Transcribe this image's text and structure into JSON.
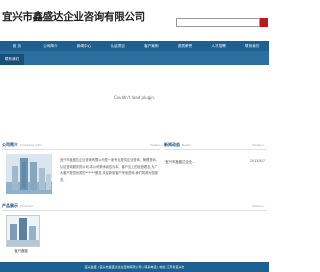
{
  "header": {
    "site_title": "宜兴市鑫盛达企业咨询有限公司"
  },
  "search": {
    "value": "",
    "placeholder": ""
  },
  "nav": {
    "items": [
      "首 页",
      "公司简介",
      "新闻中心",
      "认证项目",
      "客户案例",
      "资质荣誉",
      "人才招聘",
      "联系我们"
    ]
  },
  "submenu": {
    "active": "联系我们"
  },
  "banner": {
    "message": "Couldn't load plugin."
  },
  "company_intro": {
    "title": "公司简介",
    "subtitle": "Company intro",
    "more": "more>>",
    "text": "宜兴市鑫盛达企业咨询有限公司是一家专业提供企业咨询、管理咨询、认证咨询服务的公司,本公司秉承诚信为本、客户至上的经营理念,为广大客户提供优质的******服务,欢迎新老客户来电咨询,我们竭诚为您服务。"
  },
  "news": {
    "title": "新闻动态",
    "subtitle": "News",
    "more": "more>>",
    "items": [
      {
        "title": "·宜兴市鑫盛达企业...",
        "date": "2013/8/7"
      }
    ]
  },
  "products": {
    "title": "产品展示",
    "subtitle": "Products",
    "more": "more>>",
    "caption": "宜兴鑫盛"
  },
  "footer": {
    "text": "宜兴鑫盛 | 宜兴市鑫盛达企业咨询有限公司 | 联系电话 | 地址:江苏省宜兴市"
  },
  "colors": {
    "nav_blue": "#1d5f8f",
    "title_blue": "#1b4f78",
    "search_red": "#c0171b"
  }
}
